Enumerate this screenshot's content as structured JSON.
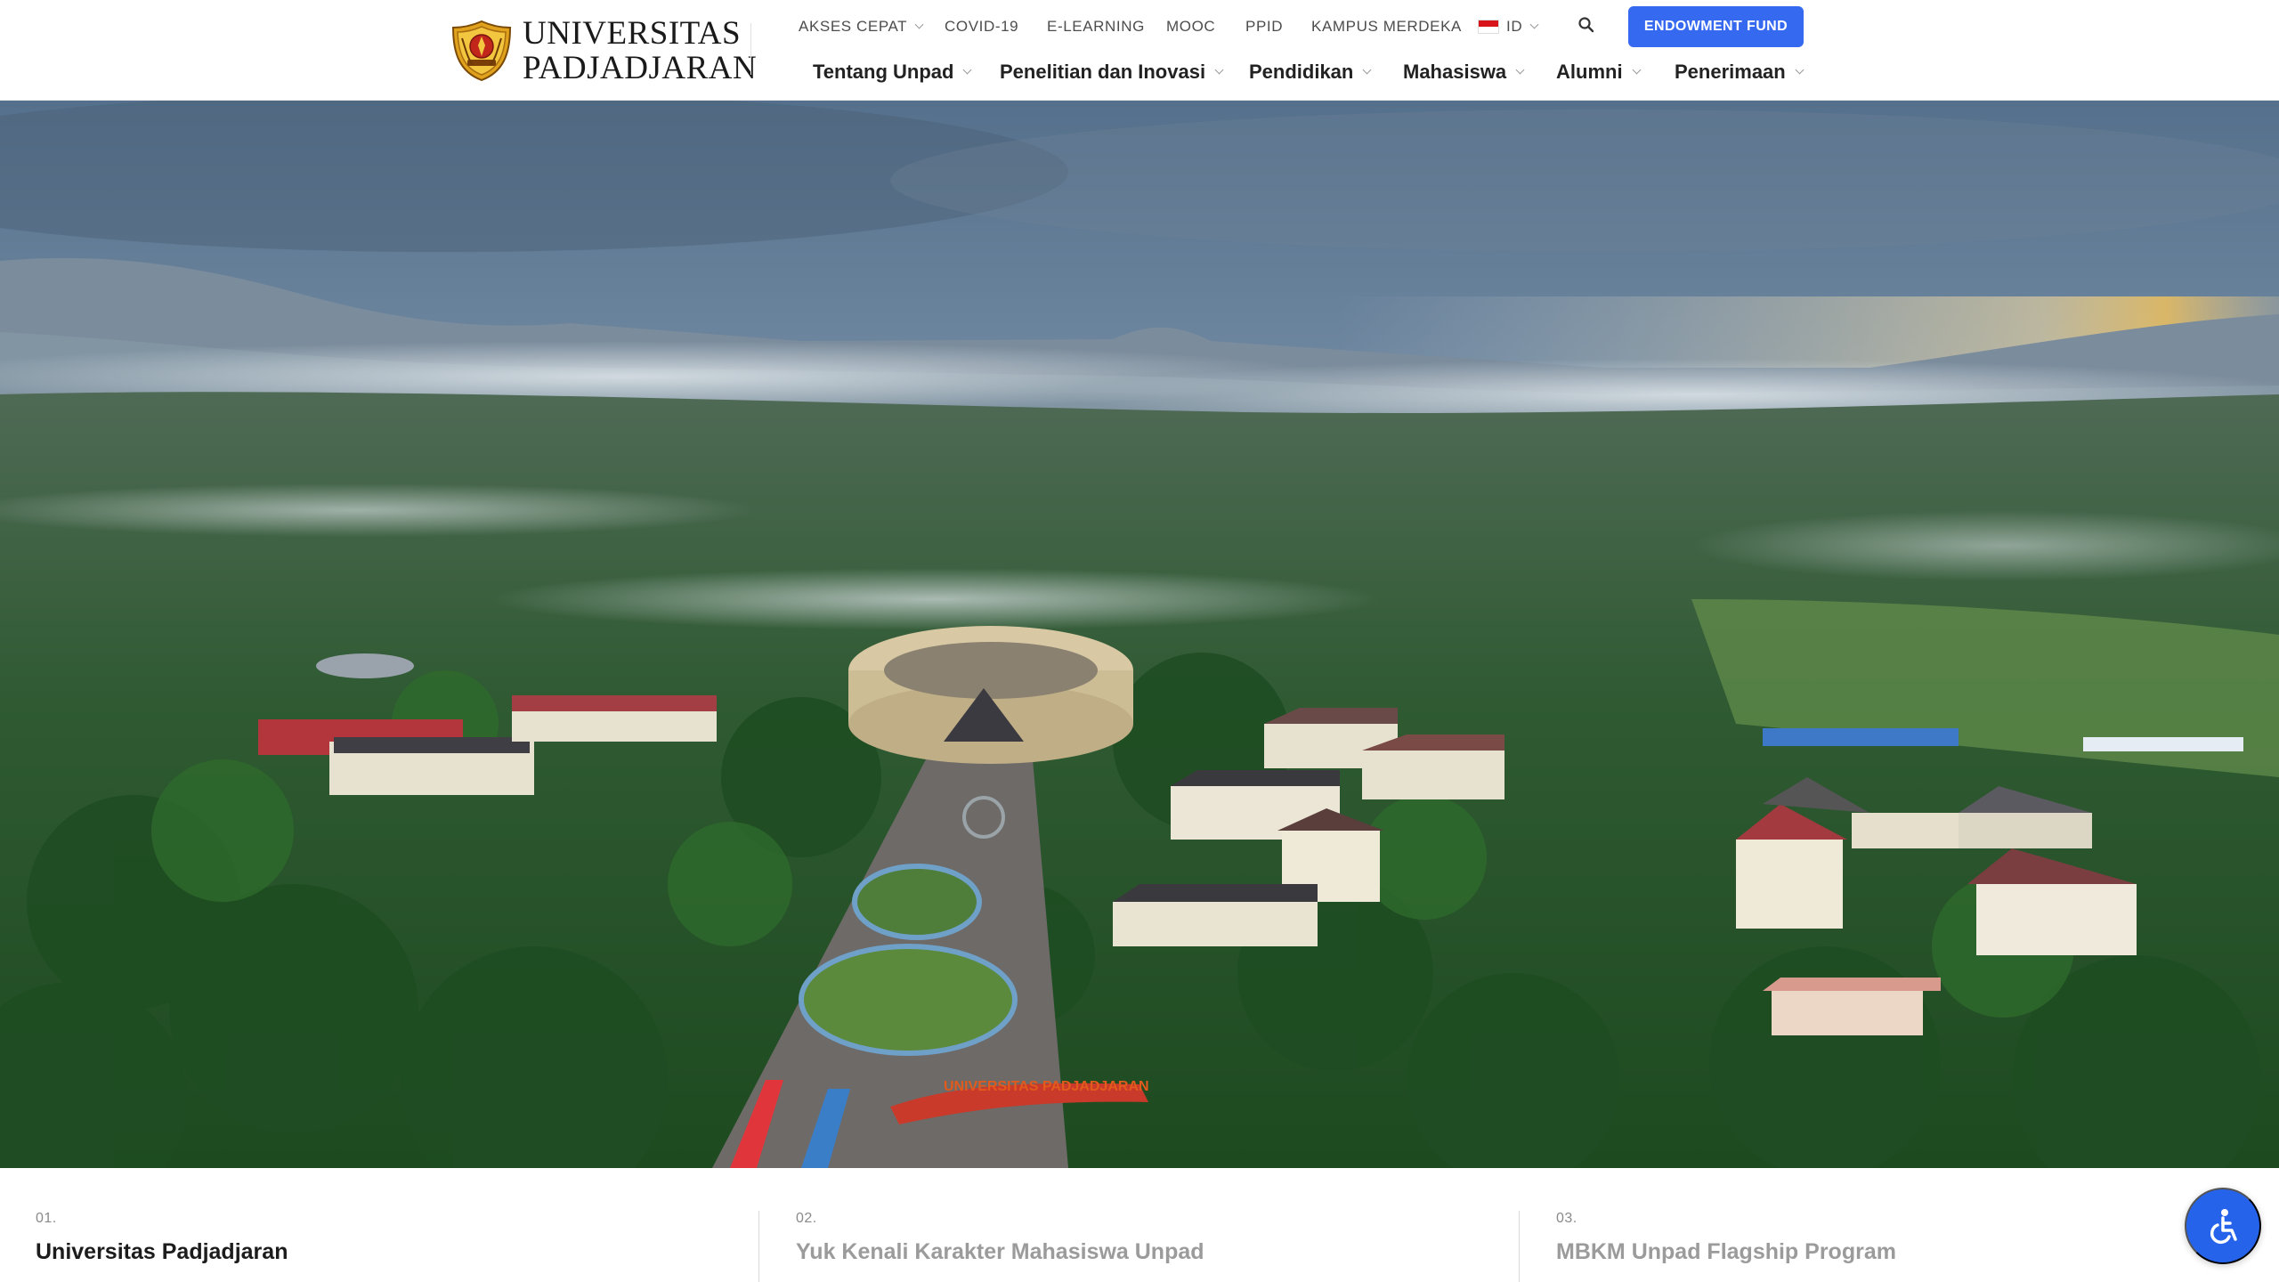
{
  "brand": {
    "line1": "UNIVERSITAS",
    "line2": "PADJADJARAN"
  },
  "top_nav": {
    "items": [
      {
        "label": "AKSES CEPAT",
        "has_dropdown": true
      },
      {
        "label": "COVID-19",
        "has_dropdown": false
      },
      {
        "label": "E-LEARNING",
        "has_dropdown": false
      },
      {
        "label": "MOOC",
        "has_dropdown": false
      },
      {
        "label": "PPID",
        "has_dropdown": false
      },
      {
        "label": "KAMPUS MERDEKA",
        "has_dropdown": false
      }
    ],
    "language": {
      "label": "ID",
      "icon": "indonesia-flag-icon"
    },
    "search_icon": "search-icon",
    "endowment_button": "ENDOWMENT FUND"
  },
  "main_nav": {
    "items": [
      {
        "label": "Tentang Unpad"
      },
      {
        "label": "Penelitian dan Inovasi"
      },
      {
        "label": "Pendidikan"
      },
      {
        "label": "Mahasiswa"
      },
      {
        "label": "Alumni"
      },
      {
        "label": "Penerimaan"
      }
    ]
  },
  "hero": {
    "image": "aerial-campus-photo",
    "slide_count": 3,
    "active_slide": 1,
    "campus_sign": "UNIVERSITAS PADJADJARAN"
  },
  "slides": [
    {
      "num": "01.",
      "title": "Universitas Padjadjaran",
      "active": true
    },
    {
      "num": "02.",
      "title": "Yuk Kenali Karakter Mahasiswa Unpad",
      "active": false
    },
    {
      "num": "03.",
      "title": "MBKM Unpad Flagship Program",
      "active": false
    }
  ],
  "accessibility_button": {
    "icon": "wheelchair-icon"
  },
  "colors": {
    "accent_blue": "#3569f0",
    "accessibility_blue": "#2563eb",
    "text_dark": "#1c1c1c",
    "text_muted": "#9b9b9b"
  }
}
